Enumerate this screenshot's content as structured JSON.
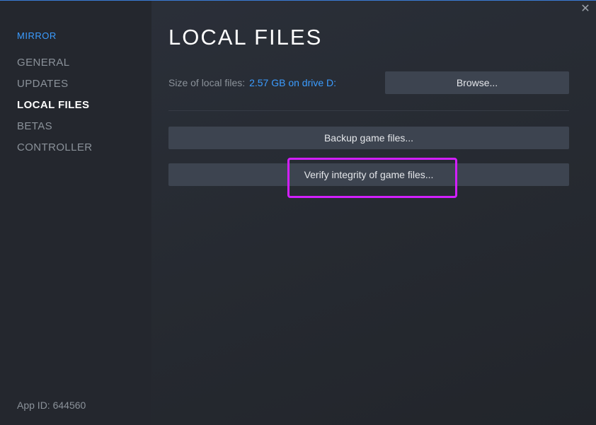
{
  "sidebar": {
    "game_name": "MIRROR",
    "items": [
      {
        "label": "GENERAL",
        "active": false
      },
      {
        "label": "UPDATES",
        "active": false
      },
      {
        "label": "LOCAL FILES",
        "active": true
      },
      {
        "label": "BETAS",
        "active": false
      },
      {
        "label": "CONTROLLER",
        "active": false
      }
    ],
    "app_id": "App ID: 644560"
  },
  "main": {
    "title": "LOCAL FILES",
    "size_label": "Size of local files:",
    "size_value": "2.57 GB on drive D:",
    "browse_label": "Browse...",
    "backup_label": "Backup game files...",
    "verify_label": "Verify integrity of game files..."
  },
  "window": {
    "close_icon": "close-icon",
    "close_glyph": "✕"
  },
  "colors": {
    "accent": "#3b9cff",
    "highlight": "#d21fff",
    "button": "#3d4450",
    "sidebar_bg": "#24272e"
  }
}
